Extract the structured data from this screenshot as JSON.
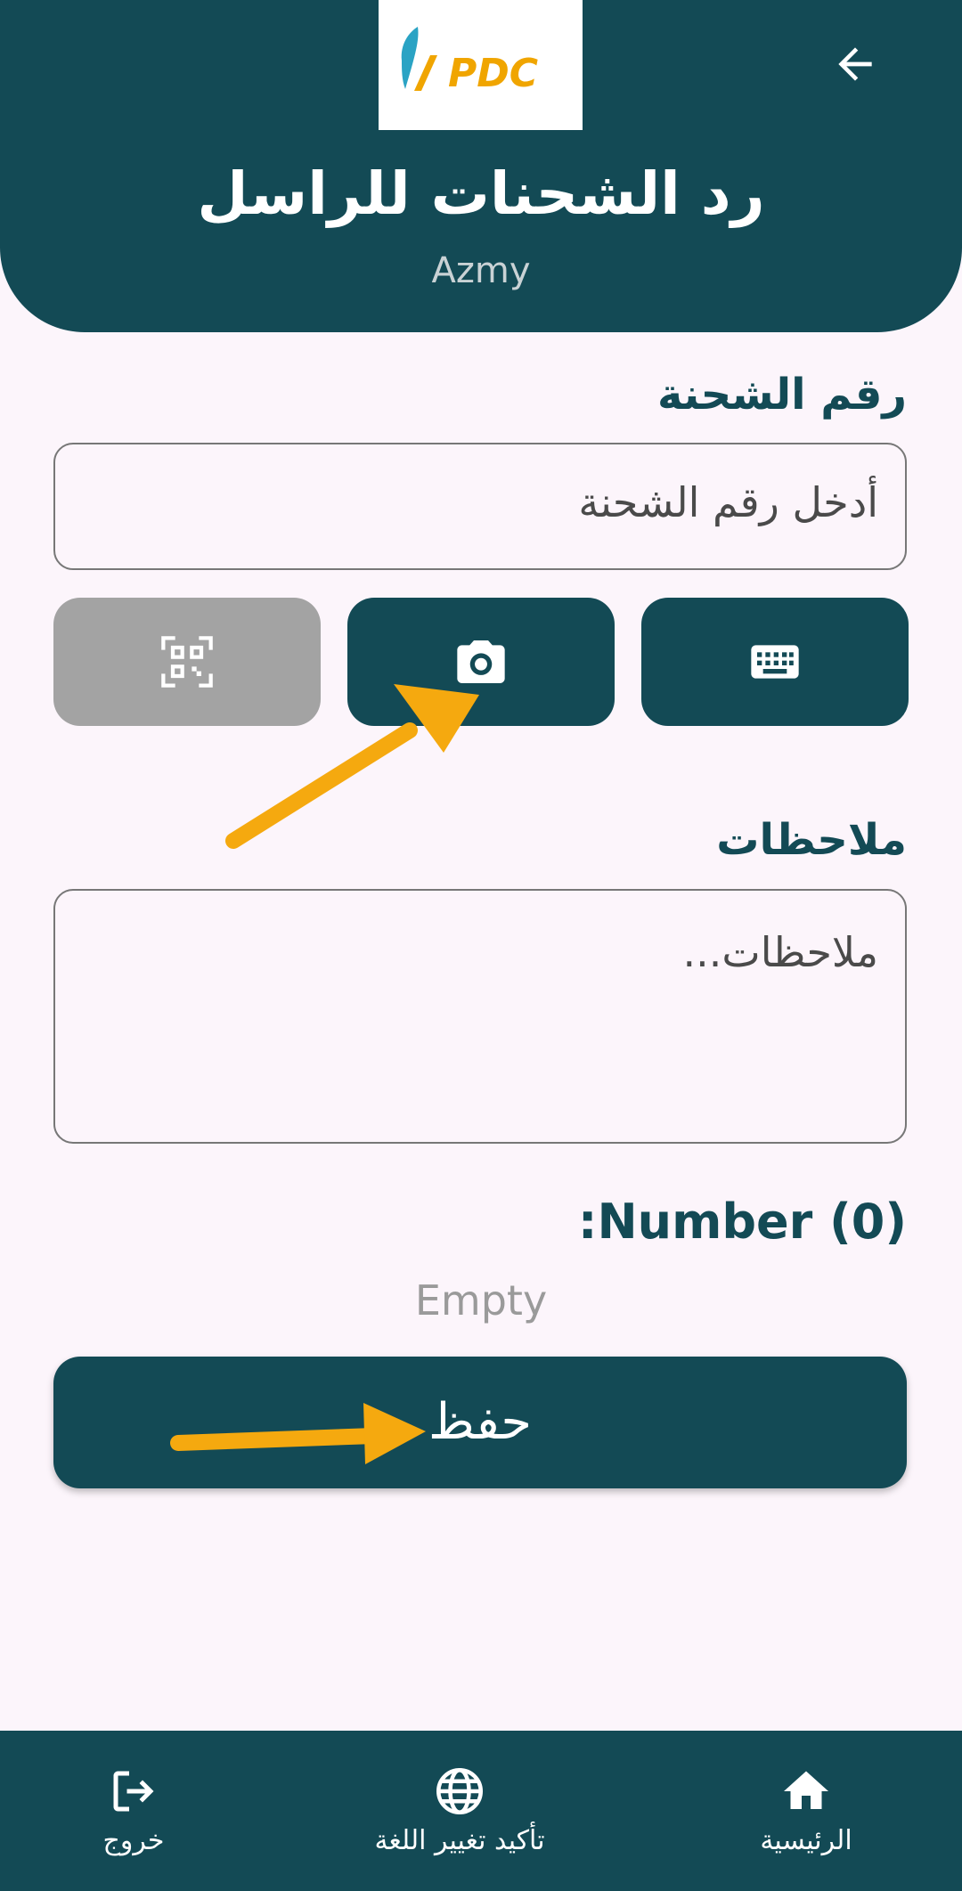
{
  "header": {
    "logo_text": "PDC",
    "title": "رد الشحنات للراسل",
    "subtitle": "Azmy",
    "back_icon": "arrow-left-icon"
  },
  "shipment": {
    "label": "رقم الشحنة",
    "placeholder": "أدخل رقم الشحنة"
  },
  "input_modes": [
    {
      "icon": "qr-scan-icon",
      "state": "disabled"
    },
    {
      "icon": "camera-icon",
      "state": "active"
    },
    {
      "icon": "keyboard-icon",
      "state": "active"
    }
  ],
  "notes": {
    "label": "ملاحظات",
    "placeholder": "ملاحظات..."
  },
  "count": {
    "label": ":Number (0)",
    "empty_text": "Empty"
  },
  "save_button": {
    "label": "حفظ"
  },
  "bottom_nav": {
    "items": [
      {
        "label": "خروج",
        "icon": "logout-icon"
      },
      {
        "label": "تأكيد تغيير اللغة",
        "icon": "globe-icon"
      },
      {
        "label": "الرئيسية",
        "icon": "home-icon"
      }
    ]
  },
  "colors": {
    "primary": "#134a55",
    "background": "#fcf5fb",
    "disabled": "#a3a3a3",
    "annotation_arrow": "#f5a90f",
    "logo_orange": "#f0a500",
    "logo_blue": "#2aa3c4"
  }
}
